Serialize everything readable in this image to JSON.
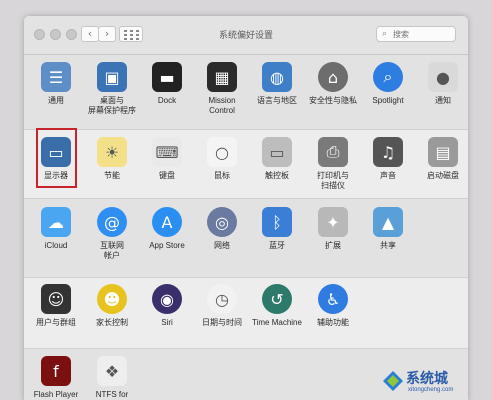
{
  "window": {
    "title": "系统偏好设置",
    "search_placeholder": "搜索",
    "back_glyph": "‹",
    "forward_glyph": "›"
  },
  "rows": [
    [
      {
        "id": "general",
        "label": "通用",
        "icon": "general-icon",
        "color": "#5d8ec6"
      },
      {
        "id": "desktop",
        "label": "桌面与\n屏幕保护程序",
        "icon": "desktop-screensaver-icon",
        "color": "#3a73b6"
      },
      {
        "id": "dock",
        "label": "Dock",
        "icon": "dock-icon",
        "color": "#222222"
      },
      {
        "id": "mission",
        "label": "Mission\nControl",
        "icon": "mission-control-icon",
        "color": "#2b2b2b"
      },
      {
        "id": "language",
        "label": "语言与地区",
        "icon": "language-region-icon",
        "color": "#3f7fc7"
      },
      {
        "id": "security",
        "label": "安全性与隐私",
        "icon": "security-privacy-icon",
        "color": "#6d6d6d"
      },
      {
        "id": "spotlight",
        "label": "Spotlight",
        "icon": "spotlight-icon",
        "color": "#2e7de0"
      },
      {
        "id": "notifications",
        "label": "通知",
        "icon": "notifications-icon",
        "color": "#d9d9d9"
      }
    ],
    [
      {
        "id": "displays",
        "label": "显示器",
        "icon": "displays-icon",
        "color": "#3a6ea8"
      },
      {
        "id": "energy",
        "label": "节能",
        "icon": "energy-saver-icon",
        "color": "#f5e08a"
      },
      {
        "id": "keyboard",
        "label": "键盘",
        "icon": "keyboard-icon",
        "color": "#e9e9e9"
      },
      {
        "id": "mouse",
        "label": "鼠标",
        "icon": "mouse-icon",
        "color": "#f4f4f4"
      },
      {
        "id": "trackpad",
        "label": "触控板",
        "icon": "trackpad-icon",
        "color": "#bdbdbd"
      },
      {
        "id": "printers",
        "label": "打印机与\n扫描仪",
        "icon": "printer-scanner-icon",
        "color": "#7a7a7a"
      },
      {
        "id": "sound",
        "label": "声音",
        "icon": "sound-icon",
        "color": "#555555"
      },
      {
        "id": "startup",
        "label": "启动磁盘",
        "icon": "startup-disk-icon",
        "color": "#9a9a9a"
      }
    ],
    [
      {
        "id": "icloud",
        "label": "iCloud",
        "icon": "icloud-icon",
        "color": "#4aa6f0"
      },
      {
        "id": "internet",
        "label": "互联网\n帐户",
        "icon": "internet-accounts-icon",
        "color": "#2f8ef2"
      },
      {
        "id": "appstore",
        "label": "App Store",
        "icon": "app-store-icon",
        "color": "#2a8ff0"
      },
      {
        "id": "network",
        "label": "网络",
        "icon": "network-icon",
        "color": "#6b7aa0"
      },
      {
        "id": "bluetooth",
        "label": "蓝牙",
        "icon": "bluetooth-icon",
        "color": "#3a7ed6"
      },
      {
        "id": "extensions",
        "label": "扩展",
        "icon": "extensions-icon",
        "color": "#b8b8b8"
      },
      {
        "id": "sharing",
        "label": "共享",
        "icon": "sharing-icon",
        "color": "#5aa0d8"
      }
    ],
    [
      {
        "id": "users",
        "label": "用户与群组",
        "icon": "users-groups-icon",
        "color": "#333333"
      },
      {
        "id": "parental",
        "label": "家长控制",
        "icon": "parental-controls-icon",
        "color": "#e8c21f"
      },
      {
        "id": "siri",
        "label": "Siri",
        "icon": "siri-icon",
        "color": "#3b2f6b"
      },
      {
        "id": "datetime",
        "label": "日期与时间",
        "icon": "date-time-icon",
        "color": "#f2f2f2"
      },
      {
        "id": "timemachine",
        "label": "Time Machine",
        "icon": "time-machine-icon",
        "color": "#2e7a6a"
      },
      {
        "id": "accessibility",
        "label": "辅助功能",
        "icon": "accessibility-icon",
        "color": "#2f7be0"
      }
    ],
    [
      {
        "id": "flash",
        "label": "Flash Player",
        "icon": "flash-player-icon",
        "color": "#7a1010"
      },
      {
        "id": "ntfs",
        "label": "NTFS for\nMac OS X",
        "icon": "ntfs-icon",
        "color": "#eeeeee"
      }
    ]
  ],
  "watermark": {
    "text": "系统城",
    "sub": "xitongcheng.com"
  }
}
